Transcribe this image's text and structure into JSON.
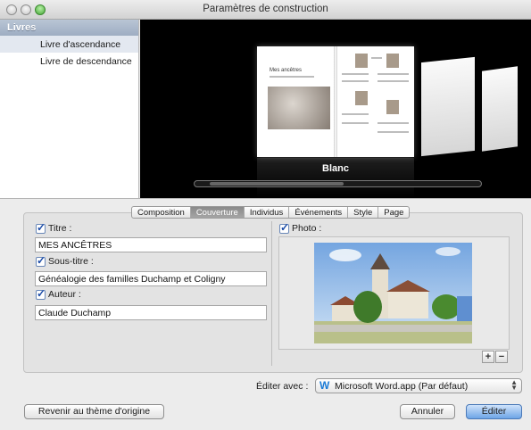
{
  "window": {
    "title": "Paramètres de construction"
  },
  "sidebar": {
    "header": "Livres",
    "items": [
      {
        "label": "Livre d'ascendance",
        "selected": true
      },
      {
        "label": "Livre de descendance",
        "selected": false
      }
    ]
  },
  "preview": {
    "theme_label": "Blanc",
    "book_title": "Mes ancêtres"
  },
  "tabs": [
    {
      "label": "Composition",
      "active": false
    },
    {
      "label": "Couverture",
      "active": true
    },
    {
      "label": "Individus",
      "active": false
    },
    {
      "label": "Événements",
      "active": false
    },
    {
      "label": "Style",
      "active": false
    },
    {
      "label": "Page",
      "active": false
    }
  ],
  "cover": {
    "title_label": "Titre :",
    "title_checked": true,
    "title_value": "MES ANCÊTRES",
    "subtitle_label": "Sous-titre :",
    "subtitle_checked": true,
    "subtitle_value": "Généalogie des familles Duchamp et Coligny",
    "author_label": "Auteur :",
    "author_checked": true,
    "author_value": "Claude Duchamp",
    "photo_label": "Photo :",
    "photo_checked": true,
    "add_label": "+",
    "remove_label": "−"
  },
  "editor": {
    "label": "Éditer avec :",
    "selected": "Microsoft Word.app (Par défaut)",
    "icon": "word-icon"
  },
  "buttons": {
    "revert": "Revenir au thème d'origine",
    "cancel": "Annuler",
    "edit": "Éditer"
  },
  "colors": {
    "accent": "#6da5e6",
    "sidebar_header": "#9eadc2",
    "checkbox": "#1d4da8"
  }
}
